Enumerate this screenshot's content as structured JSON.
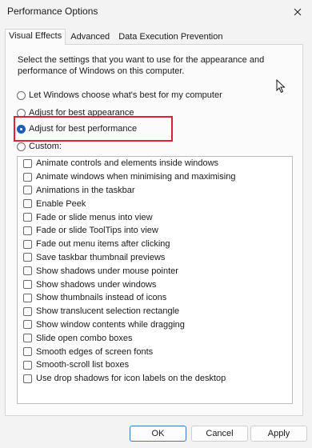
{
  "window": {
    "title": "Performance Options"
  },
  "tabs": [
    {
      "label": "Visual Effects"
    },
    {
      "label": "Advanced"
    },
    {
      "label": "Data Execution Prevention"
    }
  ],
  "description": "Select the settings that you want to use for the appearance and performance of Windows on this computer.",
  "radios": [
    {
      "label": "Let Windows choose what's best for my computer",
      "checked": false
    },
    {
      "label": "Adjust for best appearance",
      "checked": false
    },
    {
      "label": "Adjust for best performance",
      "checked": true
    },
    {
      "label": "Custom:",
      "checked": false
    }
  ],
  "effects": [
    {
      "label": "Animate controls and elements inside windows",
      "checked": false
    },
    {
      "label": "Animate windows when minimising and maximising",
      "checked": false
    },
    {
      "label": "Animations in the taskbar",
      "checked": false
    },
    {
      "label": "Enable Peek",
      "checked": false
    },
    {
      "label": "Fade or slide menus into view",
      "checked": false
    },
    {
      "label": "Fade or slide ToolTips into view",
      "checked": false
    },
    {
      "label": "Fade out menu items after clicking",
      "checked": false
    },
    {
      "label": "Save taskbar thumbnail previews",
      "checked": false
    },
    {
      "label": "Show shadows under mouse pointer",
      "checked": false
    },
    {
      "label": "Show shadows under windows",
      "checked": false
    },
    {
      "label": "Show thumbnails instead of icons",
      "checked": false
    },
    {
      "label": "Show translucent selection rectangle",
      "checked": false
    },
    {
      "label": "Show window contents while dragging",
      "checked": false
    },
    {
      "label": "Slide open combo boxes",
      "checked": false
    },
    {
      "label": "Smooth edges of screen fonts",
      "checked": false
    },
    {
      "label": "Smooth-scroll list boxes",
      "checked": false
    },
    {
      "label": "Use drop shadows for icon labels on the desktop",
      "checked": false
    }
  ],
  "buttons": {
    "ok": "OK",
    "cancel": "Cancel",
    "apply": "Apply"
  },
  "colors": {
    "accent": "#1a5fb4",
    "highlight": "#d9232d"
  }
}
